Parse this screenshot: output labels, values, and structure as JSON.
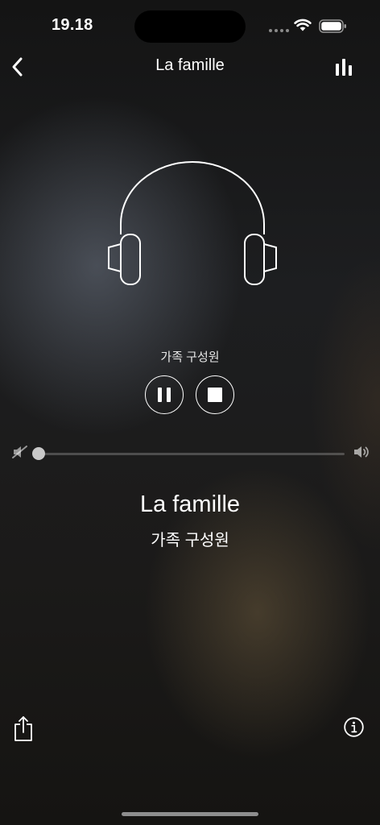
{
  "status_bar": {
    "time": "19.18"
  },
  "nav": {
    "title": "La famille",
    "back_icon": "chevron-left-icon",
    "right_icon": "equalizer-bars-icon"
  },
  "player": {
    "small_title": "가족 구성원",
    "state": "playing",
    "volume": 0.0
  },
  "track": {
    "title": "La famille",
    "subtitle": "가족 구성원"
  },
  "footer": {
    "left_icon": "share-icon",
    "right_icon": "info-icon"
  },
  "colors": {
    "text": "#ffffff",
    "slider_thumb": "#c8c8c8"
  }
}
